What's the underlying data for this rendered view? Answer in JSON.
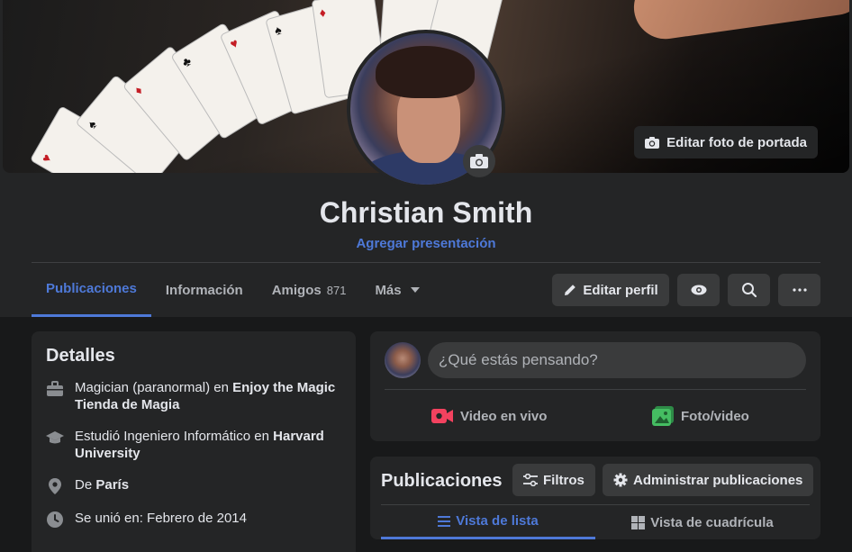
{
  "profile": {
    "name": "Christian Smith",
    "add_bio": "Agregar presentación",
    "edit_cover": "Editar foto de portada"
  },
  "tabs": [
    {
      "label": "Publicaciones",
      "active": true
    },
    {
      "label": "Información"
    },
    {
      "label": "Amigos",
      "count": "871"
    },
    {
      "label": "Más"
    }
  ],
  "actions": {
    "edit_profile": "Editar perfil"
  },
  "details": {
    "title": "Detalles",
    "work": {
      "role": "Magician (paranormal) en ",
      "place": "Enjoy the Magic Tienda de Magia"
    },
    "study": {
      "text": "Estudió Ingeniero Informático en ",
      "place": "Harvard University"
    },
    "from": {
      "prefix": "De ",
      "place": "París"
    },
    "joined": "Se unió en: Febrero de 2014"
  },
  "composer": {
    "placeholder": "¿Qué estás pensando?",
    "live_video": "Video en vivo",
    "photo_video": "Foto/video"
  },
  "posts": {
    "title": "Publicaciones",
    "filters": "Filtros",
    "manage": "Administrar publicaciones",
    "list_view": "Vista de lista",
    "grid_view": "Vista de cuadrícula"
  },
  "colors": {
    "accent": "#4e79d8",
    "live_red": "#f3425f",
    "photo_green": "#45bd62",
    "surface": "#242526",
    "background": "#18191a"
  }
}
